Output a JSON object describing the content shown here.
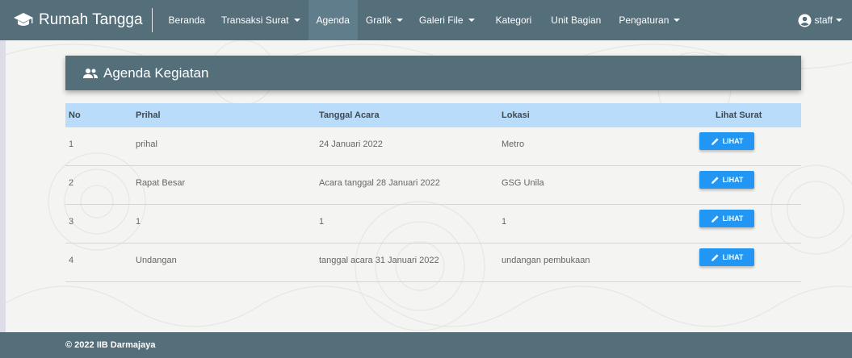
{
  "navbar": {
    "brand": "Rumah Tangga",
    "items": [
      {
        "label": "Beranda",
        "dropdown": false,
        "active": false
      },
      {
        "label": "Transaksi Surat",
        "dropdown": true,
        "active": false
      },
      {
        "label": "Agenda",
        "dropdown": false,
        "active": true
      },
      {
        "label": "Grafik",
        "dropdown": true,
        "active": false
      },
      {
        "label": "Galeri File",
        "dropdown": true,
        "active": false
      },
      {
        "label": "Kategori",
        "dropdown": false,
        "active": false
      },
      {
        "label": "Unit Bagian",
        "dropdown": false,
        "active": false
      },
      {
        "label": "Pengaturan",
        "dropdown": true,
        "active": false
      }
    ],
    "user": "staff"
  },
  "card": {
    "title": "Agenda Kegiatan",
    "icon": "group-icon"
  },
  "table": {
    "headers": [
      "No",
      "Prihal",
      "Tanggal Acara",
      "Lokasi",
      "Lihat Surat"
    ],
    "rows": [
      {
        "no": "1",
        "prihal": "prihal",
        "tanggal": "24 Januari 2022",
        "lokasi": "Metro",
        "action": "LIHAT"
      },
      {
        "no": "2",
        "prihal": "Rapat Besar",
        "tanggal": "Acara tanggal 28 Januari 2022",
        "lokasi": "GSG Unila",
        "action": "LIHAT"
      },
      {
        "no": "3",
        "prihal": "1",
        "tanggal": "1",
        "lokasi": "1",
        "action": "LIHAT"
      },
      {
        "no": "4",
        "prihal": "Undangan",
        "tanggal": "tanggal acara 31 Januari 2022",
        "lokasi": "undangan pembukaan",
        "action": "LIHAT"
      }
    ]
  },
  "footer": {
    "text": "© 2022 IIB Darmajaya"
  },
  "colors": {
    "navbar": "#546e7a",
    "table_header": "#b9dcfb",
    "button": "#2196f3"
  }
}
